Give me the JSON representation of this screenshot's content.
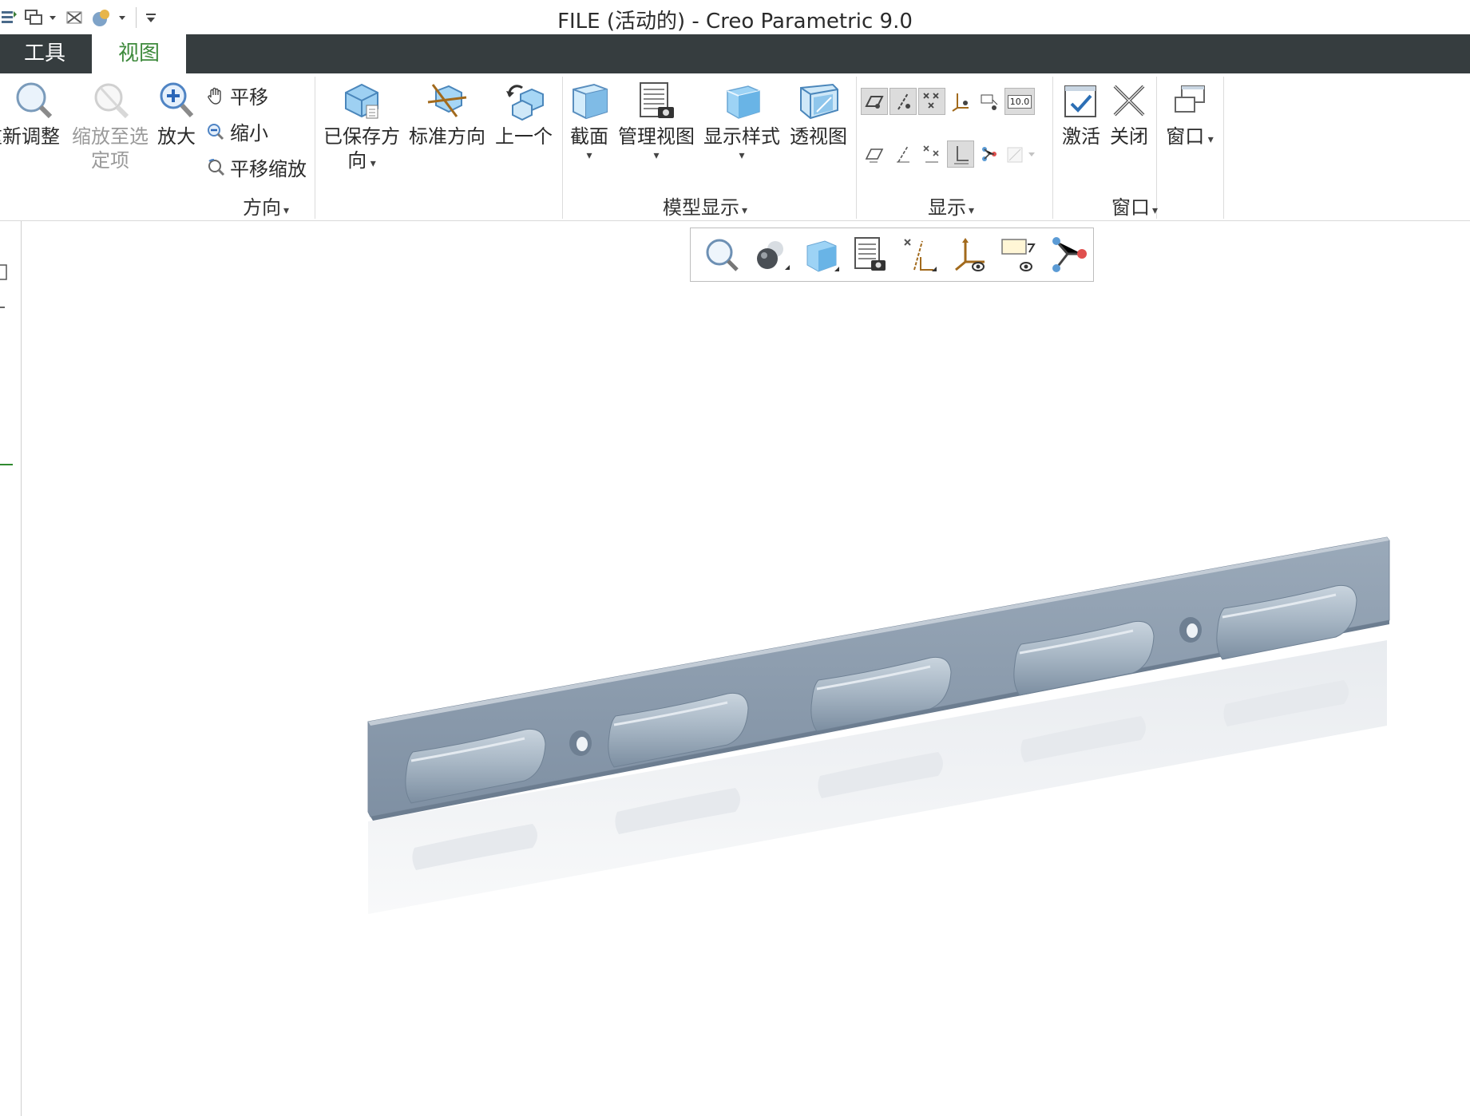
{
  "window": {
    "title": "FILE (活动的) - Creo Parametric 9.0"
  },
  "quick_access": {
    "items": [
      "regenerate-icon",
      "windows-icon",
      "close-window-icon",
      "display-icon",
      "customize-icon"
    ]
  },
  "tabs": [
    {
      "label": "工具",
      "active": false
    },
    {
      "label": "视图",
      "active": true
    }
  ],
  "ribbon": {
    "orientation": {
      "label": "方向",
      "refit": "重新调整",
      "zoom_selected": [
        "缩放至选",
        "定项"
      ],
      "zoom_in": "放大",
      "pan": "平移",
      "zoom_out": "缩小",
      "pan_zoom": "平移缩放",
      "saved_orientations": [
        "已保存方",
        "向"
      ],
      "standard_orientation": "标准方向",
      "previous": "上一个"
    },
    "model_display": {
      "label": "模型显示",
      "section": "截面",
      "manage_views": "管理视图",
      "display_style": "显示样式",
      "perspective": "透视图"
    },
    "show": {
      "label": "显示",
      "note_value": "10.0"
    },
    "window": {
      "label": "窗口",
      "activate": "激活",
      "close": "关闭",
      "windows": "窗口"
    }
  },
  "view_toolbar": {
    "items": [
      "refit-icon",
      "zoom-in-icon",
      "display-style-icon",
      "saved-views-icon",
      "datum-display-filter-icon",
      "coordinate-system-icon",
      "annotation-display-icon",
      "spin-center-icon"
    ]
  },
  "colors": {
    "tab_bar": "#363d3f",
    "active_tab_text": "#3e8a3c",
    "model_face": "#8c9cae",
    "model_top": "#b4bfcb",
    "reflection": "#eef0f3"
  }
}
